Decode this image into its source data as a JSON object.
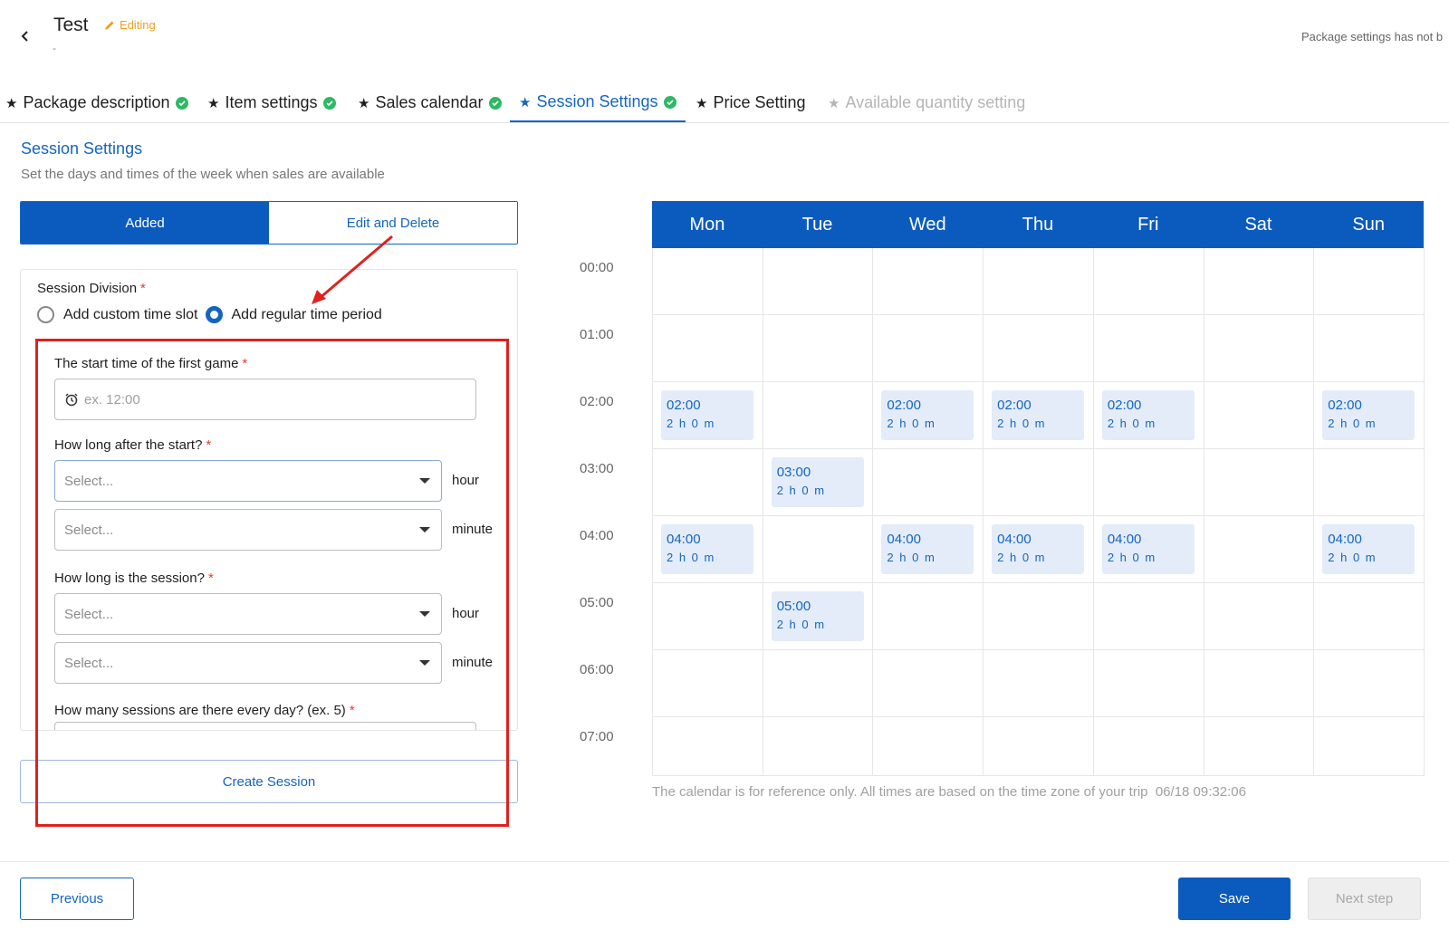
{
  "header": {
    "title": "Test",
    "editing_label": "Editing",
    "subtitle": "-",
    "notice": "Package settings has not b"
  },
  "tabs": [
    {
      "label": "Package description",
      "state": "done"
    },
    {
      "label": "Item settings",
      "state": "done"
    },
    {
      "label": "Sales calendar",
      "state": "done"
    },
    {
      "label": "Session Settings",
      "state": "active"
    },
    {
      "label": "Price Setting",
      "state": "pending"
    },
    {
      "label": "Available quantity setting",
      "state": "disabled"
    }
  ],
  "section": {
    "title": "Session Settings",
    "description": "Set the days and times of the week when sales are available"
  },
  "mode_toggle": {
    "added": "Added",
    "edit_delete": "Edit and Delete"
  },
  "form": {
    "division_label": "Session Division",
    "radio_custom": "Add custom time slot",
    "radio_regular": "Add regular time period",
    "start_label": "The start time of the first game",
    "start_placeholder": "ex. 12:00",
    "after_label": "How long after the start?",
    "session_label": "How long is the session?",
    "count_label": "How many sessions are there every day? (ex. 5)",
    "select_placeholder": "Select...",
    "unit_hour": "hour",
    "unit_minute": "minute",
    "required_mark": "*"
  },
  "create_button": "Create Session",
  "calendar": {
    "days": [
      "Mon",
      "Tue",
      "Wed",
      "Thu",
      "Fri",
      "Sat",
      "Sun"
    ],
    "times": [
      "00:00",
      "01:00",
      "02:00",
      "03:00",
      "04:00",
      "05:00",
      "06:00",
      "07:00"
    ],
    "sessions": [
      {
        "day": "Mon",
        "time": "02:00",
        "duration": "2 h 0 m"
      },
      {
        "day": "Wed",
        "time": "02:00",
        "duration": "2 h 0 m"
      },
      {
        "day": "Thu",
        "time": "02:00",
        "duration": "2 h 0 m"
      },
      {
        "day": "Fri",
        "time": "02:00",
        "duration": "2 h 0 m"
      },
      {
        "day": "Sun",
        "time": "02:00",
        "duration": "2 h 0 m"
      },
      {
        "day": "Tue",
        "time": "03:00",
        "duration": "2 h 0 m"
      },
      {
        "day": "Mon",
        "time": "04:00",
        "duration": "2 h 0 m"
      },
      {
        "day": "Wed",
        "time": "04:00",
        "duration": "2 h 0 m"
      },
      {
        "day": "Thu",
        "time": "04:00",
        "duration": "2 h 0 m"
      },
      {
        "day": "Fri",
        "time": "04:00",
        "duration": "2 h 0 m"
      },
      {
        "day": "Sun",
        "time": "04:00",
        "duration": "2 h 0 m"
      },
      {
        "day": "Tue",
        "time": "05:00",
        "duration": "2 h 0 m"
      }
    ],
    "note": "The calendar is for reference only. All times are based on the time zone of your trip",
    "timestamp": "06/18 09:32:06"
  },
  "footer": {
    "previous": "Previous",
    "save": "Save",
    "next": "Next step"
  },
  "colors": {
    "primary": "#0b5bbf",
    "link": "#1565c0",
    "success": "#2fb865",
    "warning": "#f0a020",
    "annotation": "#e0211d",
    "slot_bg": "#e3ecf8"
  }
}
